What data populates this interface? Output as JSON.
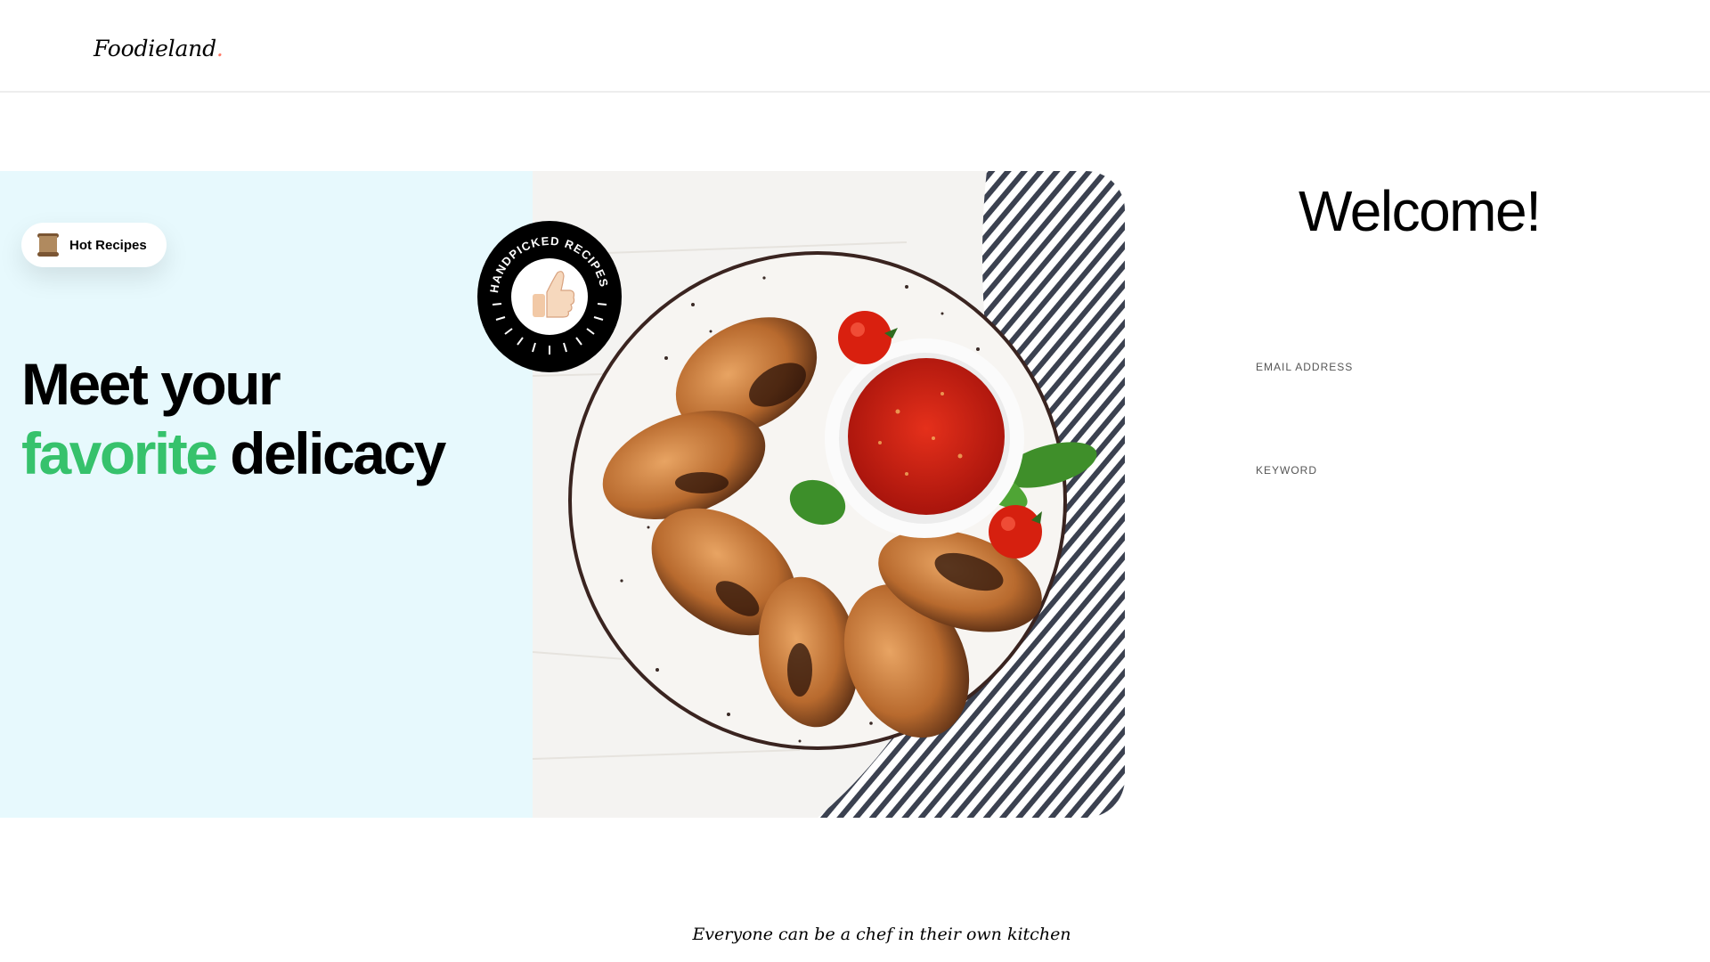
{
  "header": {
    "logo_text": "Foodieland",
    "logo_dot": "."
  },
  "hero": {
    "pill_label": "Hot Recipes",
    "pill_icon": "scroll-icon",
    "headline_line1": "Meet your",
    "headline_green": "favorite",
    "headline_rest": " delicacy",
    "badge_text": "HANDPICKED RECIPES",
    "badge_icon": "thumbs-up-icon",
    "image_subject": "grilled-chicken-wings-plate"
  },
  "form": {
    "title": "Welcome!",
    "email_label": "EMAIL ADDRESS",
    "email_placeholder": "",
    "keyword_label": "KEYWORD",
    "keyword_placeholder": ""
  },
  "footer": {
    "tagline": "Everyone can be a chef in their own kitchen"
  },
  "colors": {
    "accent_green": "#36c26c",
    "hero_background": "#e7f9fd",
    "logo_dot": "#ff7967"
  }
}
